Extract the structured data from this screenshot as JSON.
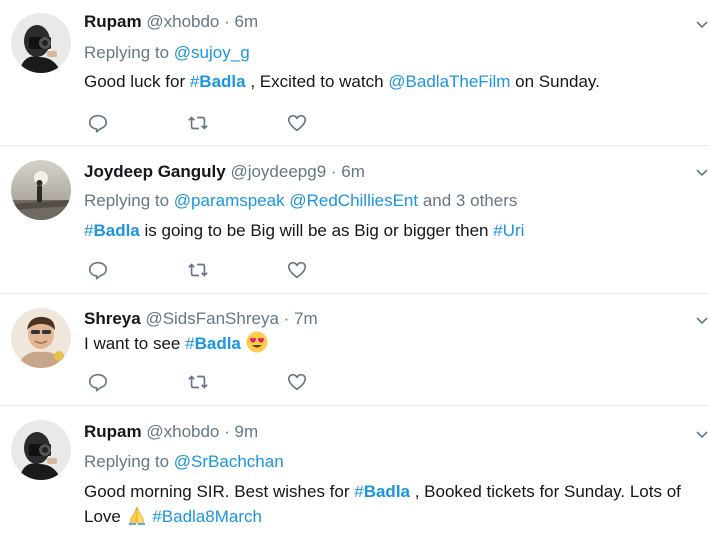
{
  "tweets": [
    {
      "display_name": "Rupam",
      "handle": "@xhobdo",
      "dot": "·",
      "time": "6m",
      "replying_label": "Replying to",
      "replying_to": [
        "@sujoy_g"
      ],
      "replying_suffix": "",
      "text": {
        "p1": "Good luck for ",
        "tag1_hash": "#",
        "tag1_word": "Badla",
        "p2": " , Excited to watch ",
        "mention1": "@BadlaTheFilm",
        "p3": " on Sunday."
      }
    },
    {
      "display_name": "Joydeep Ganguly",
      "handle": "@joydeepg9",
      "dot": "·",
      "time": "6m",
      "replying_label": "Replying to",
      "replying_to": [
        "@paramspeak",
        "@RedChilliesEnt"
      ],
      "replying_suffix": "and 3 others",
      "text": {
        "tag1_hash": "#",
        "tag1_word": "Badla",
        "p1": " is going to be Big will be as Big or bigger then ",
        "tag2_hash": "#",
        "tag2_word": "Uri"
      }
    },
    {
      "display_name": "Shreya",
      "handle": "@SidsFanShreya",
      "dot": "·",
      "time": "7m",
      "text": {
        "p1": "I want to see ",
        "tag1_hash": "#",
        "tag1_word": "Badla",
        "emoji": "heart-eyes-emoji"
      }
    },
    {
      "display_name": "Rupam",
      "handle": "@xhobdo",
      "dot": "·",
      "time": "9m",
      "replying_label": "Replying to",
      "replying_to": [
        "@SrBachchan"
      ],
      "replying_suffix": "",
      "text": {
        "p1": "Good morning SIR. Best wishes for ",
        "tag1_hash": "#",
        "tag1_word": "Badla",
        "p2": " , Booked tickets for Sunday. Lots of",
        "p3": "Love ",
        "emoji": "folded-hands-emoji",
        "tag2": "#Badla8March"
      }
    }
  ],
  "icons": {
    "reply": "reply-icon",
    "retweet": "retweet-icon",
    "like": "heart-icon",
    "caret": "chevron-down-icon"
  },
  "colors": {
    "link": "#1b95e0",
    "secondary_text": "#657786",
    "primary_text": "#14171a",
    "divider": "#e6ecf0"
  }
}
